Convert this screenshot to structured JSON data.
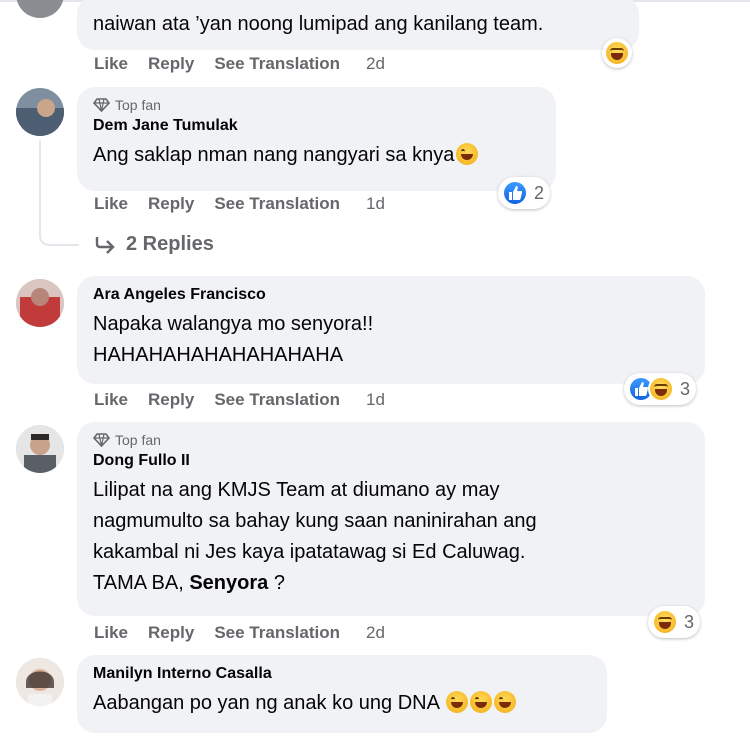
{
  "comments": [
    {
      "author": "",
      "text": "naiwan ata ’yan noong lumipad ang kanilang team.",
      "actions": {
        "like": "Like",
        "reply": "Reply",
        "translate": "See Translation",
        "time": "2d"
      }
    },
    {
      "badge": "Top fan",
      "author": "Dem Jane Tumulak",
      "text": "Ang saklap nman nang nangyari sa knya",
      "reaction_count": "2",
      "actions": {
        "like": "Like",
        "reply": "Reply",
        "translate": "See Translation",
        "time": "1d"
      },
      "replies_label": "2 Replies"
    },
    {
      "author": "Ara Angeles Francisco",
      "text": "Napaka walangya mo senyora!!\nHAHAHAHAHAHAHAHAHA",
      "reaction_count": "3",
      "actions": {
        "like": "Like",
        "reply": "Reply",
        "translate": "See Translation",
        "time": "1d"
      }
    },
    {
      "badge": "Top fan",
      "author": "Dong Fullo II",
      "text_lines": [
        "Lilipat na ang KMJS Team at diumano ay may",
        "nagmumulto sa bahay kung saan naninirahan ang",
        "kakambal ni Jes kaya ipatatawag si Ed Caluwag.",
        "TAMA BA,"
      ],
      "mention": "Senyora",
      "tail": " ?",
      "reaction_count": "3",
      "actions": {
        "like": "Like",
        "reply": "Reply",
        "translate": "See Translation",
        "time": "2d"
      }
    },
    {
      "author": "Manilyn Interno Casalla",
      "text": "Aabangan po yan ng anak ko ung DNA"
    }
  ],
  "icons": {
    "badge": "diamond-icon",
    "reply_arrow": "reply-arrow-icon",
    "like_reaction": "like-reaction-icon",
    "haha_reaction": "haha-reaction-icon",
    "laughing_emoji": "rofl-emoji-icon"
  },
  "colors": {
    "bubble_bg": "#f0f2f5",
    "meta_text": "#65676b",
    "like_blue": "#1877f2",
    "haha_yellow": "#f7b928"
  }
}
